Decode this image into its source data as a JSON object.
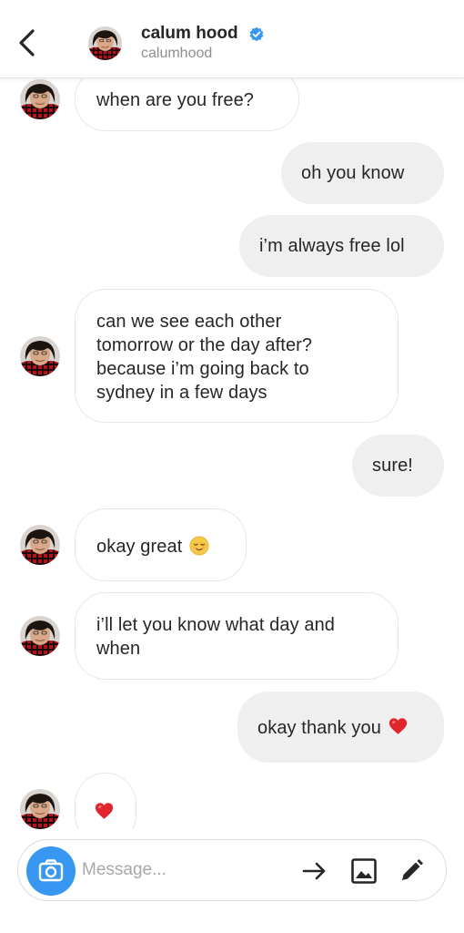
{
  "header": {
    "name": "calum hood",
    "username": "calumhood",
    "verified": true,
    "verified_color": "#3897f0"
  },
  "messages": [
    {
      "sender": "them",
      "text": "when are you free?"
    },
    {
      "sender": "me",
      "text": "oh you know"
    },
    {
      "sender": "me",
      "text": "i’m always free lol"
    },
    {
      "sender": "them",
      "text": "can we see each other\ntomorrow or the day after?\nbecause i’m going back to\nsydney in a few days"
    },
    {
      "sender": "me",
      "text": "sure!"
    },
    {
      "sender": "them",
      "text": "okay great",
      "emoji": "relieved-face-emoji"
    },
    {
      "sender": "them",
      "text": "i’ll let you know what day and\nwhen"
    },
    {
      "sender": "me",
      "text": "okay thank you",
      "emoji": "red-heart-emoji"
    },
    {
      "sender": "them",
      "text": "",
      "emoji": "red-heart-emoji"
    }
  ],
  "composer": {
    "placeholder": "Message...",
    "icons": [
      "camera-icon",
      "send-arrow-icon",
      "gallery-icon",
      "pencil-icon"
    ],
    "accent_color": "#3897f0"
  },
  "colors": {
    "outgoing_bubble": "#efefef",
    "incoming_bubble_border": "#e6e6e6",
    "heart": "#e0252d"
  }
}
